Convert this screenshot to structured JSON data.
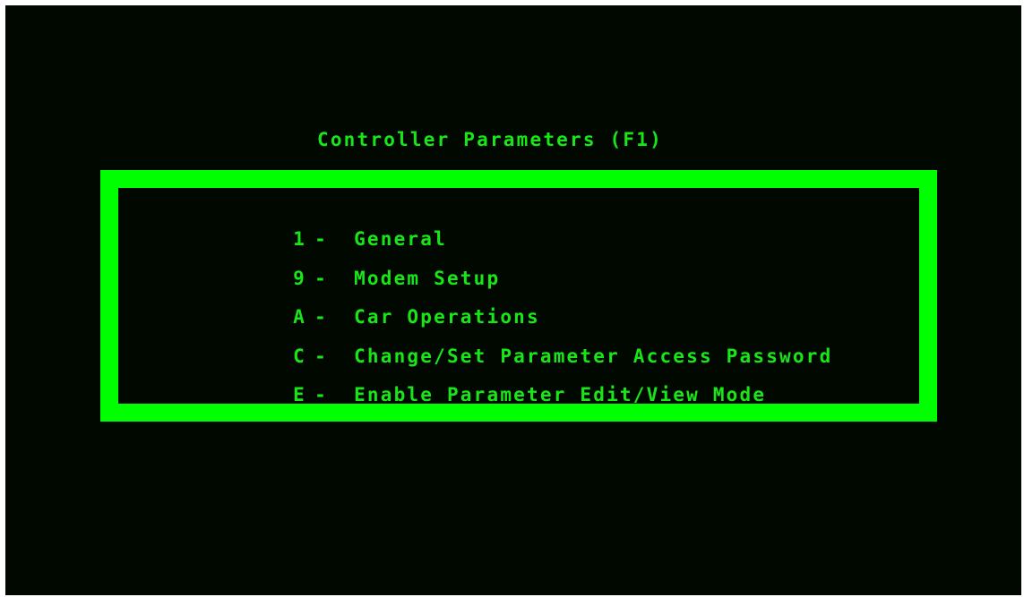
{
  "screen": {
    "title": "Controller Parameters (F1)"
  },
  "menu": {
    "items": [
      {
        "key": "1",
        "separator": "-",
        "label": "General"
      },
      {
        "key": "9",
        "separator": "-",
        "label": "Modem Setup"
      },
      {
        "key": "A",
        "separator": "-",
        "label": "Car Operations"
      },
      {
        "key": "C",
        "separator": "-",
        "label": "Change/Set Parameter Access Password"
      },
      {
        "key": "E",
        "separator": "-",
        "label": "Enable Parameter Edit/View Mode"
      }
    ]
  },
  "colors": {
    "background": "#000800",
    "text": "#19e619",
    "border": "#00ff00"
  }
}
